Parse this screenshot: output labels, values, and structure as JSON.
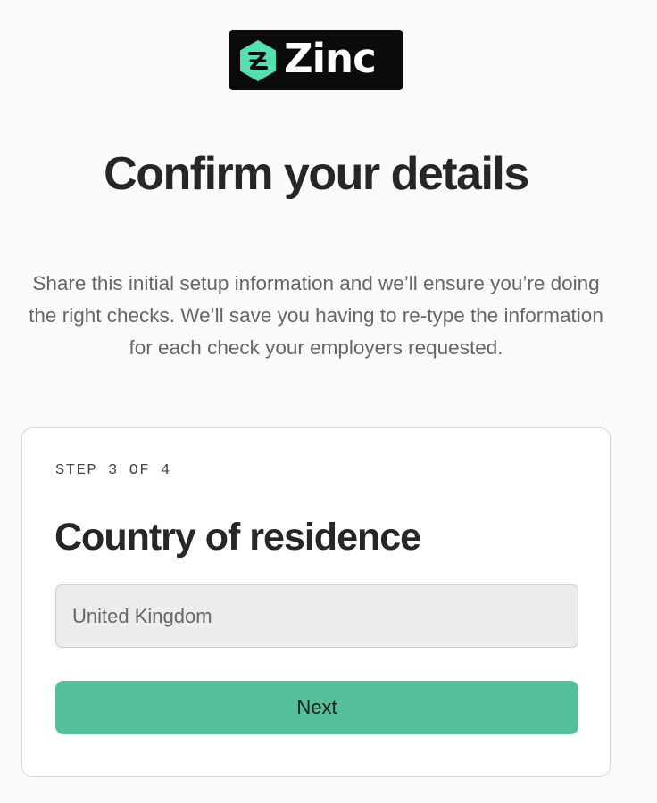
{
  "brand": {
    "name": "Zinc",
    "logo_icon": "zinc-hexagon-logo-icon",
    "accent_color": "#55bf9a",
    "logo_background": "#0b0b0b"
  },
  "page": {
    "title": "Confirm your details",
    "intro": "Share this initial setup information and we’ll ensure you’re doing the right checks. We’ll save you having to re-type the information for each check your employers requested."
  },
  "form": {
    "step_label": "STEP 3 OF 4",
    "heading": "Country of residence",
    "country_value": "United Kingdom",
    "next_label": "Next"
  }
}
